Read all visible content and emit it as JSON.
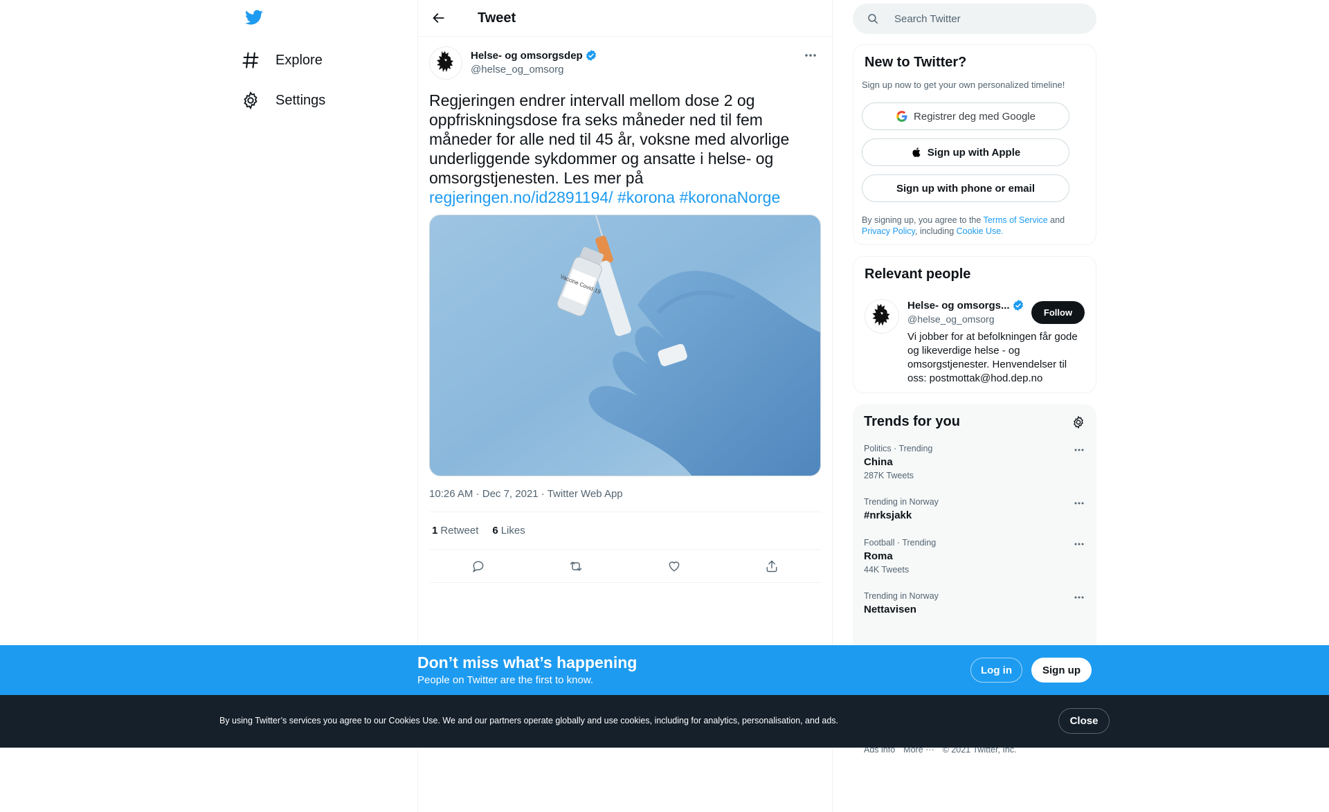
{
  "colors": {
    "accent": "#1d9bf0",
    "text": "#0f1419",
    "muted": "#536471",
    "cookie_bg": "#15202b"
  },
  "nav": {
    "logo_icon": "twitter-bird-icon",
    "items": [
      {
        "label": "Explore",
        "icon": "hashtag-icon"
      },
      {
        "label": "Settings",
        "icon": "gear-icon"
      }
    ]
  },
  "header": {
    "title": "Tweet"
  },
  "tweet": {
    "author_name": "Helse- og omsorgsdep",
    "author_handle": "@helse_og_omsorg",
    "text": "Regjeringen endrer intervall mellom dose 2 og oppfriskningsdose fra seks måneder ned til fem måneder for alle ned til 45 år, voksne med alvorlige underliggende sykdommer og ansatte i helse- og omsorgstjenesten. Les mer på ",
    "link_text": "regjeringen.no/id2891194/",
    "hashtag_1": "#korona",
    "hashtag_2": "#koronaNorge",
    "media_label": "Vaccine Covid-19",
    "time": "10:26 AM",
    "date": "Dec 7, 2021",
    "client": "Twitter Web App",
    "retweets": "1",
    "retweets_label": "Retweet",
    "likes": "6",
    "likes_label": "Likes"
  },
  "search": {
    "placeholder": "Search Twitter"
  },
  "signup_card": {
    "title": "New to Twitter?",
    "subtitle": "Sign up now to get your own personalized timeline!",
    "google": "Registrer deg med Google",
    "apple": "Sign up with Apple",
    "phone": "Sign up with phone or email",
    "terms_1": "By signing up, you agree to the ",
    "terms_link_1": "Terms of Service",
    "terms_2": " and ",
    "terms_link_2": "Privacy Policy",
    "terms_3": ", including ",
    "terms_link_3": "Cookie Use."
  },
  "people": {
    "title": "Relevant people",
    "name": "Helse- og omsorgs...",
    "handle": "@helse_og_omsorg",
    "follow": "Follow",
    "bio": "Vi jobber for at befolkningen får gode og likeverdige helse - og omsorgstjenester. Henvendelser til oss: postmottak@hod.dep.no"
  },
  "trends": {
    "title": "Trends for you",
    "items": [
      {
        "context": "Politics · Trending",
        "name": "China",
        "count": "287K Tweets"
      },
      {
        "context": "Trending in Norway",
        "name": "#nrksjakk",
        "count": ""
      },
      {
        "context": "Football · Trending",
        "name": "Roma",
        "count": "44K Tweets"
      },
      {
        "context": "Trending in Norway",
        "name": "Nettavisen",
        "count": ""
      }
    ]
  },
  "footer": {
    "ads": "Ads info",
    "more": "More ···",
    "copyright": "© 2021 Twitter, Inc."
  },
  "signup_bar": {
    "title": "Don’t miss what’s happening",
    "subtitle": "People on Twitter are the first to know.",
    "login": "Log in",
    "signup": "Sign up"
  },
  "cookie_bar": {
    "text": "By using Twitter’s services you agree to our Cookies Use. We and our partners operate globally and use cookies, including for analytics, personalisation, and ads.",
    "close": "Close"
  }
}
